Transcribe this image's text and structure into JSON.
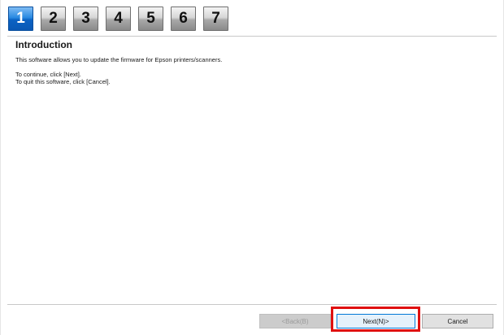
{
  "steps": [
    "1",
    "2",
    "3",
    "4",
    "5",
    "6",
    "7"
  ],
  "active_step": "1",
  "page": {
    "heading": "Introduction",
    "line1": "This software allows you to update the firmware for Epson printers/scanners.",
    "line2": "To continue, click [Next].",
    "line3": "To quit this software, click [Cancel]."
  },
  "buttons": {
    "back_label": "<Back(B)",
    "next_label": "Next(N)>",
    "cancel_label": "Cancel"
  },
  "colors": {
    "active_step": "#0b62c4",
    "highlight": "#e01010"
  }
}
